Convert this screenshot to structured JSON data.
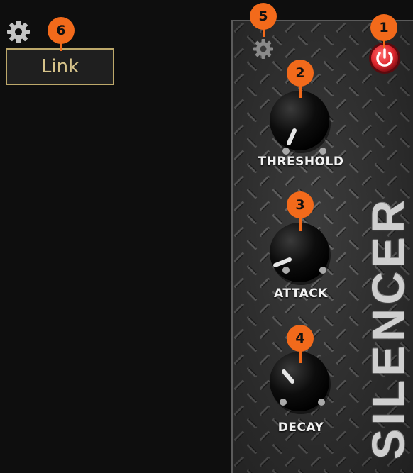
{
  "toolbar": {
    "settings_icon": "gear-icon",
    "link_label": "Link"
  },
  "plugin": {
    "brand": "SILENCER",
    "power_icon": "power-icon",
    "settings_icon": "gear-icon",
    "knobs": [
      {
        "label": "THRESHOLD",
        "level": 0.12
      },
      {
        "label": "ATTACK",
        "level": 0.05
      },
      {
        "label": "DECAY",
        "level": 0.38
      }
    ]
  },
  "callouts": [
    "1",
    "2",
    "3",
    "4",
    "5",
    "6"
  ],
  "colors": {
    "accent": "#f26a1b",
    "power_on": "#e0282f",
    "link_border": "#bda86a",
    "link_text": "#d6c38a"
  }
}
